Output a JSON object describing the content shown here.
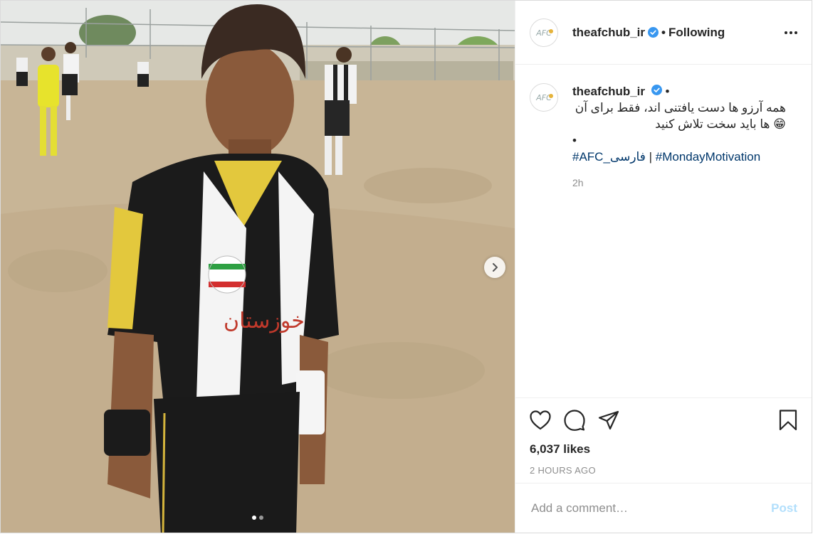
{
  "post": {
    "account": {
      "username": "theafchub_ir",
      "verified": true,
      "follow_state": "Following",
      "avatar_logo_text": "AFC"
    },
    "media": {
      "description_icon": "photo",
      "carousel_index": 1,
      "carousel_total": 2,
      "shirt_text": "خوزستان"
    },
    "caption": {
      "username": "theafchub_ir",
      "separator": "•",
      "line1": "همه آرزو ها دست یافتنی اند، فقط برای آن",
      "line2": "ها باید سخت تلاش کنید",
      "emoji": "😁",
      "bullet": "•",
      "hashtag1": "#AFC_فارسی",
      "tag_divider": "|",
      "hashtag2": "#MondayMotivation",
      "time": "2h"
    },
    "stats": {
      "likes": "6,037 likes",
      "posted_ago": "2 HOURS AGO"
    },
    "comment_box": {
      "placeholder": "Add a comment…",
      "post_label": "Post"
    },
    "icons": {
      "like": "heart-icon",
      "comment": "comment-icon",
      "share": "paper-plane-icon",
      "save": "bookmark-icon",
      "more": "more-options-icon",
      "verified": "verified-badge-icon",
      "next": "chevron-right-icon"
    },
    "colors": {
      "link": "#00376b",
      "verified": "#3897f0",
      "post_button_disabled": "#b2dffc",
      "secondary_text": "#8e8e8e"
    }
  }
}
